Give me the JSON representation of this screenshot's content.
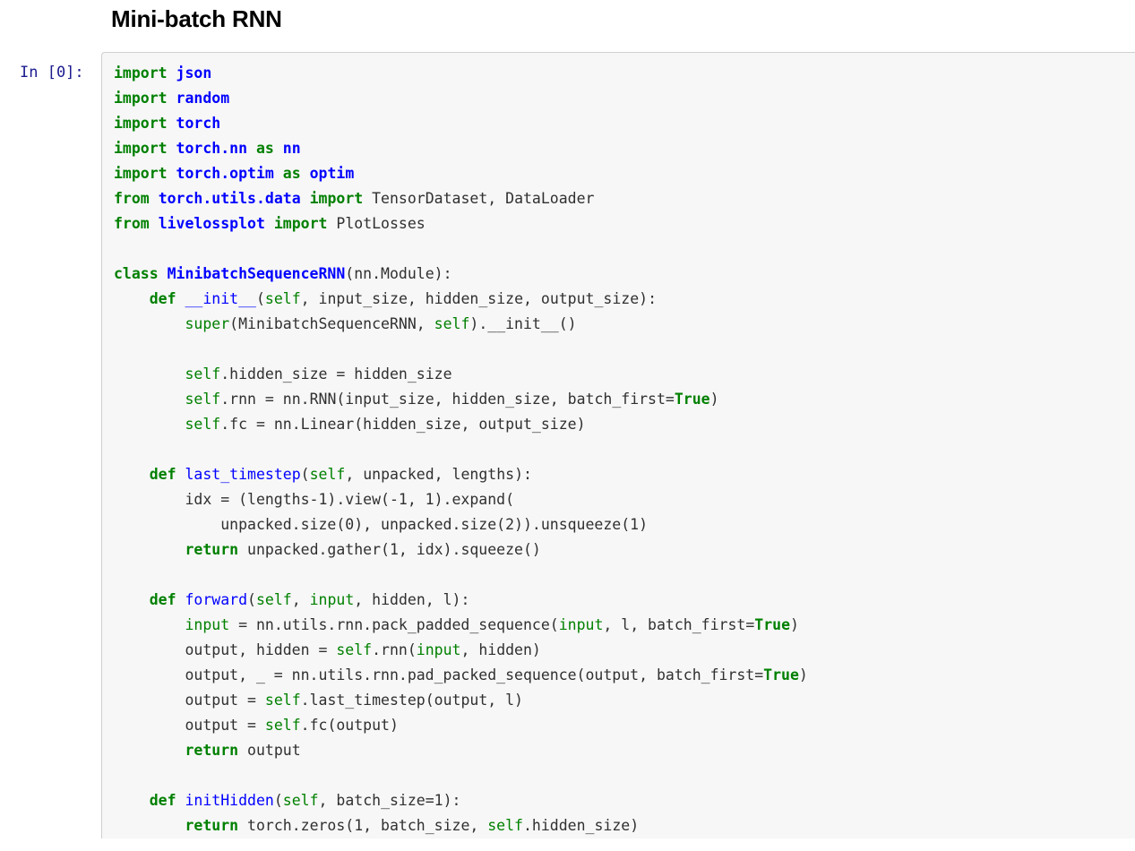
{
  "notebook": {
    "heading": "Mini-batch RNN",
    "cell": {
      "prompt": "In [0]:",
      "code_plain": "import json\nimport random\nimport torch\nimport torch.nn as nn\nimport torch.optim as optim\nfrom torch.utils.data import TensorDataset, DataLoader\nfrom livelossplot import PlotLosses\n\nclass MinibatchSequenceRNN(nn.Module):\n    def __init__(self, input_size, hidden_size, output_size):\n        super(MinibatchSequenceRNN, self).__init__()\n\n        self.hidden_size = hidden_size\n        self.rnn = nn.RNN(input_size, hidden_size, batch_first=True)\n        self.fc = nn.Linear(hidden_size, output_size)\n\n    def last_timestep(self, unpacked, lengths):\n        idx = (lengths-1).view(-1, 1).expand(\n            unpacked.size(0), unpacked.size(2)).unsqueeze(1)\n        return unpacked.gather(1, idx).squeeze()\n\n    def forward(self, input, hidden, l):\n        input = nn.utils.rnn.pack_padded_sequence(input, l, batch_first=True)\n        output, hidden = self.rnn(input, hidden)\n        output, _ = nn.utils.rnn.pad_packed_sequence(output, batch_first=True)\n        output = self.last_timestep(output, l)\n        output = self.fc(output)\n        return output\n\n    def initHidden(self, batch_size=1):\n        return torch.zeros(1, batch_size, self.hidden_size)",
      "lines": [
        [
          {
            "t": "import",
            "c": "k"
          },
          {
            "t": " ",
            "c": "n"
          },
          {
            "t": "json",
            "c": "nn"
          }
        ],
        [
          {
            "t": "import",
            "c": "k"
          },
          {
            "t": " ",
            "c": "n"
          },
          {
            "t": "random",
            "c": "nn"
          }
        ],
        [
          {
            "t": "import",
            "c": "k"
          },
          {
            "t": " ",
            "c": "n"
          },
          {
            "t": "torch",
            "c": "nn"
          }
        ],
        [
          {
            "t": "import",
            "c": "k"
          },
          {
            "t": " ",
            "c": "n"
          },
          {
            "t": "torch.nn",
            "c": "nn"
          },
          {
            "t": " ",
            "c": "n"
          },
          {
            "t": "as",
            "c": "k"
          },
          {
            "t": " ",
            "c": "n"
          },
          {
            "t": "nn",
            "c": "nn"
          }
        ],
        [
          {
            "t": "import",
            "c": "k"
          },
          {
            "t": " ",
            "c": "n"
          },
          {
            "t": "torch.optim",
            "c": "nn"
          },
          {
            "t": " ",
            "c": "n"
          },
          {
            "t": "as",
            "c": "k"
          },
          {
            "t": " ",
            "c": "n"
          },
          {
            "t": "optim",
            "c": "nn"
          }
        ],
        [
          {
            "t": "from",
            "c": "k"
          },
          {
            "t": " ",
            "c": "n"
          },
          {
            "t": "torch.utils.data",
            "c": "nn"
          },
          {
            "t": " ",
            "c": "n"
          },
          {
            "t": "import",
            "c": "k"
          },
          {
            "t": " TensorDataset, DataLoader",
            "c": "n"
          }
        ],
        [
          {
            "t": "from",
            "c": "k"
          },
          {
            "t": " ",
            "c": "n"
          },
          {
            "t": "livelossplot",
            "c": "nn"
          },
          {
            "t": " ",
            "c": "n"
          },
          {
            "t": "import",
            "c": "k"
          },
          {
            "t": " PlotLosses",
            "c": "n"
          }
        ],
        [],
        [
          {
            "t": "class",
            "c": "k"
          },
          {
            "t": " ",
            "c": "n"
          },
          {
            "t": "MinibatchSequenceRNN",
            "c": "nc"
          },
          {
            "t": "(nn.Module):",
            "c": "n"
          }
        ],
        [
          {
            "t": "    ",
            "c": "n"
          },
          {
            "t": "def",
            "c": "k"
          },
          {
            "t": " ",
            "c": "n"
          },
          {
            "t": "__init__",
            "c": "nf"
          },
          {
            "t": "(",
            "c": "n"
          },
          {
            "t": "self",
            "c": "bp"
          },
          {
            "t": ", input_size, hidden_size, output_size):",
            "c": "n"
          }
        ],
        [
          {
            "t": "        ",
            "c": "n"
          },
          {
            "t": "super",
            "c": "nb"
          },
          {
            "t": "(MinibatchSequenceRNN, ",
            "c": "n"
          },
          {
            "t": "self",
            "c": "bp"
          },
          {
            "t": ").__init__()",
            "c": "n"
          }
        ],
        [],
        [
          {
            "t": "        ",
            "c": "n"
          },
          {
            "t": "self",
            "c": "bp"
          },
          {
            "t": ".hidden_size = hidden_size",
            "c": "n"
          }
        ],
        [
          {
            "t": "        ",
            "c": "n"
          },
          {
            "t": "self",
            "c": "bp"
          },
          {
            "t": ".rnn = nn.RNN(input_size, hidden_size, batch_first=",
            "c": "n"
          },
          {
            "t": "True",
            "c": "kc"
          },
          {
            "t": ")",
            "c": "n"
          }
        ],
        [
          {
            "t": "        ",
            "c": "n"
          },
          {
            "t": "self",
            "c": "bp"
          },
          {
            "t": ".fc = nn.Linear(hidden_size, output_size)",
            "c": "n"
          }
        ],
        [],
        [
          {
            "t": "    ",
            "c": "n"
          },
          {
            "t": "def",
            "c": "k"
          },
          {
            "t": " ",
            "c": "n"
          },
          {
            "t": "last_timestep",
            "c": "nf"
          },
          {
            "t": "(",
            "c": "n"
          },
          {
            "t": "self",
            "c": "bp"
          },
          {
            "t": ", unpacked, lengths):",
            "c": "n"
          }
        ],
        [
          {
            "t": "        idx = (lengths-1).view(-1, 1).expand(",
            "c": "n"
          }
        ],
        [
          {
            "t": "            unpacked.size(0), unpacked.size(2)).unsqueeze(1)",
            "c": "n"
          }
        ],
        [
          {
            "t": "        ",
            "c": "n"
          },
          {
            "t": "return",
            "c": "k"
          },
          {
            "t": " unpacked.gather(1, idx).squeeze()",
            "c": "n"
          }
        ],
        [],
        [
          {
            "t": "    ",
            "c": "n"
          },
          {
            "t": "def",
            "c": "k"
          },
          {
            "t": " ",
            "c": "n"
          },
          {
            "t": "forward",
            "c": "nf"
          },
          {
            "t": "(",
            "c": "n"
          },
          {
            "t": "self",
            "c": "bp"
          },
          {
            "t": ", ",
            "c": "n"
          },
          {
            "t": "input",
            "c": "nb"
          },
          {
            "t": ", hidden, l):",
            "c": "n"
          }
        ],
        [
          {
            "t": "        ",
            "c": "n"
          },
          {
            "t": "input",
            "c": "nb"
          },
          {
            "t": " = nn.utils.rnn.pack_padded_sequence(",
            "c": "n"
          },
          {
            "t": "input",
            "c": "nb"
          },
          {
            "t": ", l, batch_first=",
            "c": "n"
          },
          {
            "t": "True",
            "c": "kc"
          },
          {
            "t": ")",
            "c": "n"
          }
        ],
        [
          {
            "t": "        output, hidden = ",
            "c": "n"
          },
          {
            "t": "self",
            "c": "bp"
          },
          {
            "t": ".rnn(",
            "c": "n"
          },
          {
            "t": "input",
            "c": "nb"
          },
          {
            "t": ", hidden)",
            "c": "n"
          }
        ],
        [
          {
            "t": "        output, _ = nn.utils.rnn.pad_packed_sequence(output, batch_first=",
            "c": "n"
          },
          {
            "t": "True",
            "c": "kc"
          },
          {
            "t": ")",
            "c": "n"
          }
        ],
        [
          {
            "t": "        output = ",
            "c": "n"
          },
          {
            "t": "self",
            "c": "bp"
          },
          {
            "t": ".last_timestep(output, l)",
            "c": "n"
          }
        ],
        [
          {
            "t": "        output = ",
            "c": "n"
          },
          {
            "t": "self",
            "c": "bp"
          },
          {
            "t": ".fc(output)",
            "c": "n"
          }
        ],
        [
          {
            "t": "        ",
            "c": "n"
          },
          {
            "t": "return",
            "c": "k"
          },
          {
            "t": " output",
            "c": "n"
          }
        ],
        [],
        [
          {
            "t": "    ",
            "c": "n"
          },
          {
            "t": "def",
            "c": "k"
          },
          {
            "t": " ",
            "c": "n"
          },
          {
            "t": "initHidden",
            "c": "nf"
          },
          {
            "t": "(",
            "c": "n"
          },
          {
            "t": "self",
            "c": "bp"
          },
          {
            "t": ", batch_size=1):",
            "c": "n"
          }
        ],
        [
          {
            "t": "        ",
            "c": "n"
          },
          {
            "t": "return",
            "c": "k"
          },
          {
            "t": " torch.zeros(1, batch_size, ",
            "c": "n"
          },
          {
            "t": "self",
            "c": "bp"
          },
          {
            "t": ".hidden_size)",
            "c": "n"
          }
        ]
      ]
    }
  },
  "colors": {
    "keyword": "#008000",
    "module": "#0000ff",
    "builtin": "#008000",
    "text": "#303030",
    "prompt": "#1b1b8f",
    "cell_background": "#f7f7f7",
    "cell_border": "#cfcfcf",
    "page_background": "#ffffff"
  }
}
